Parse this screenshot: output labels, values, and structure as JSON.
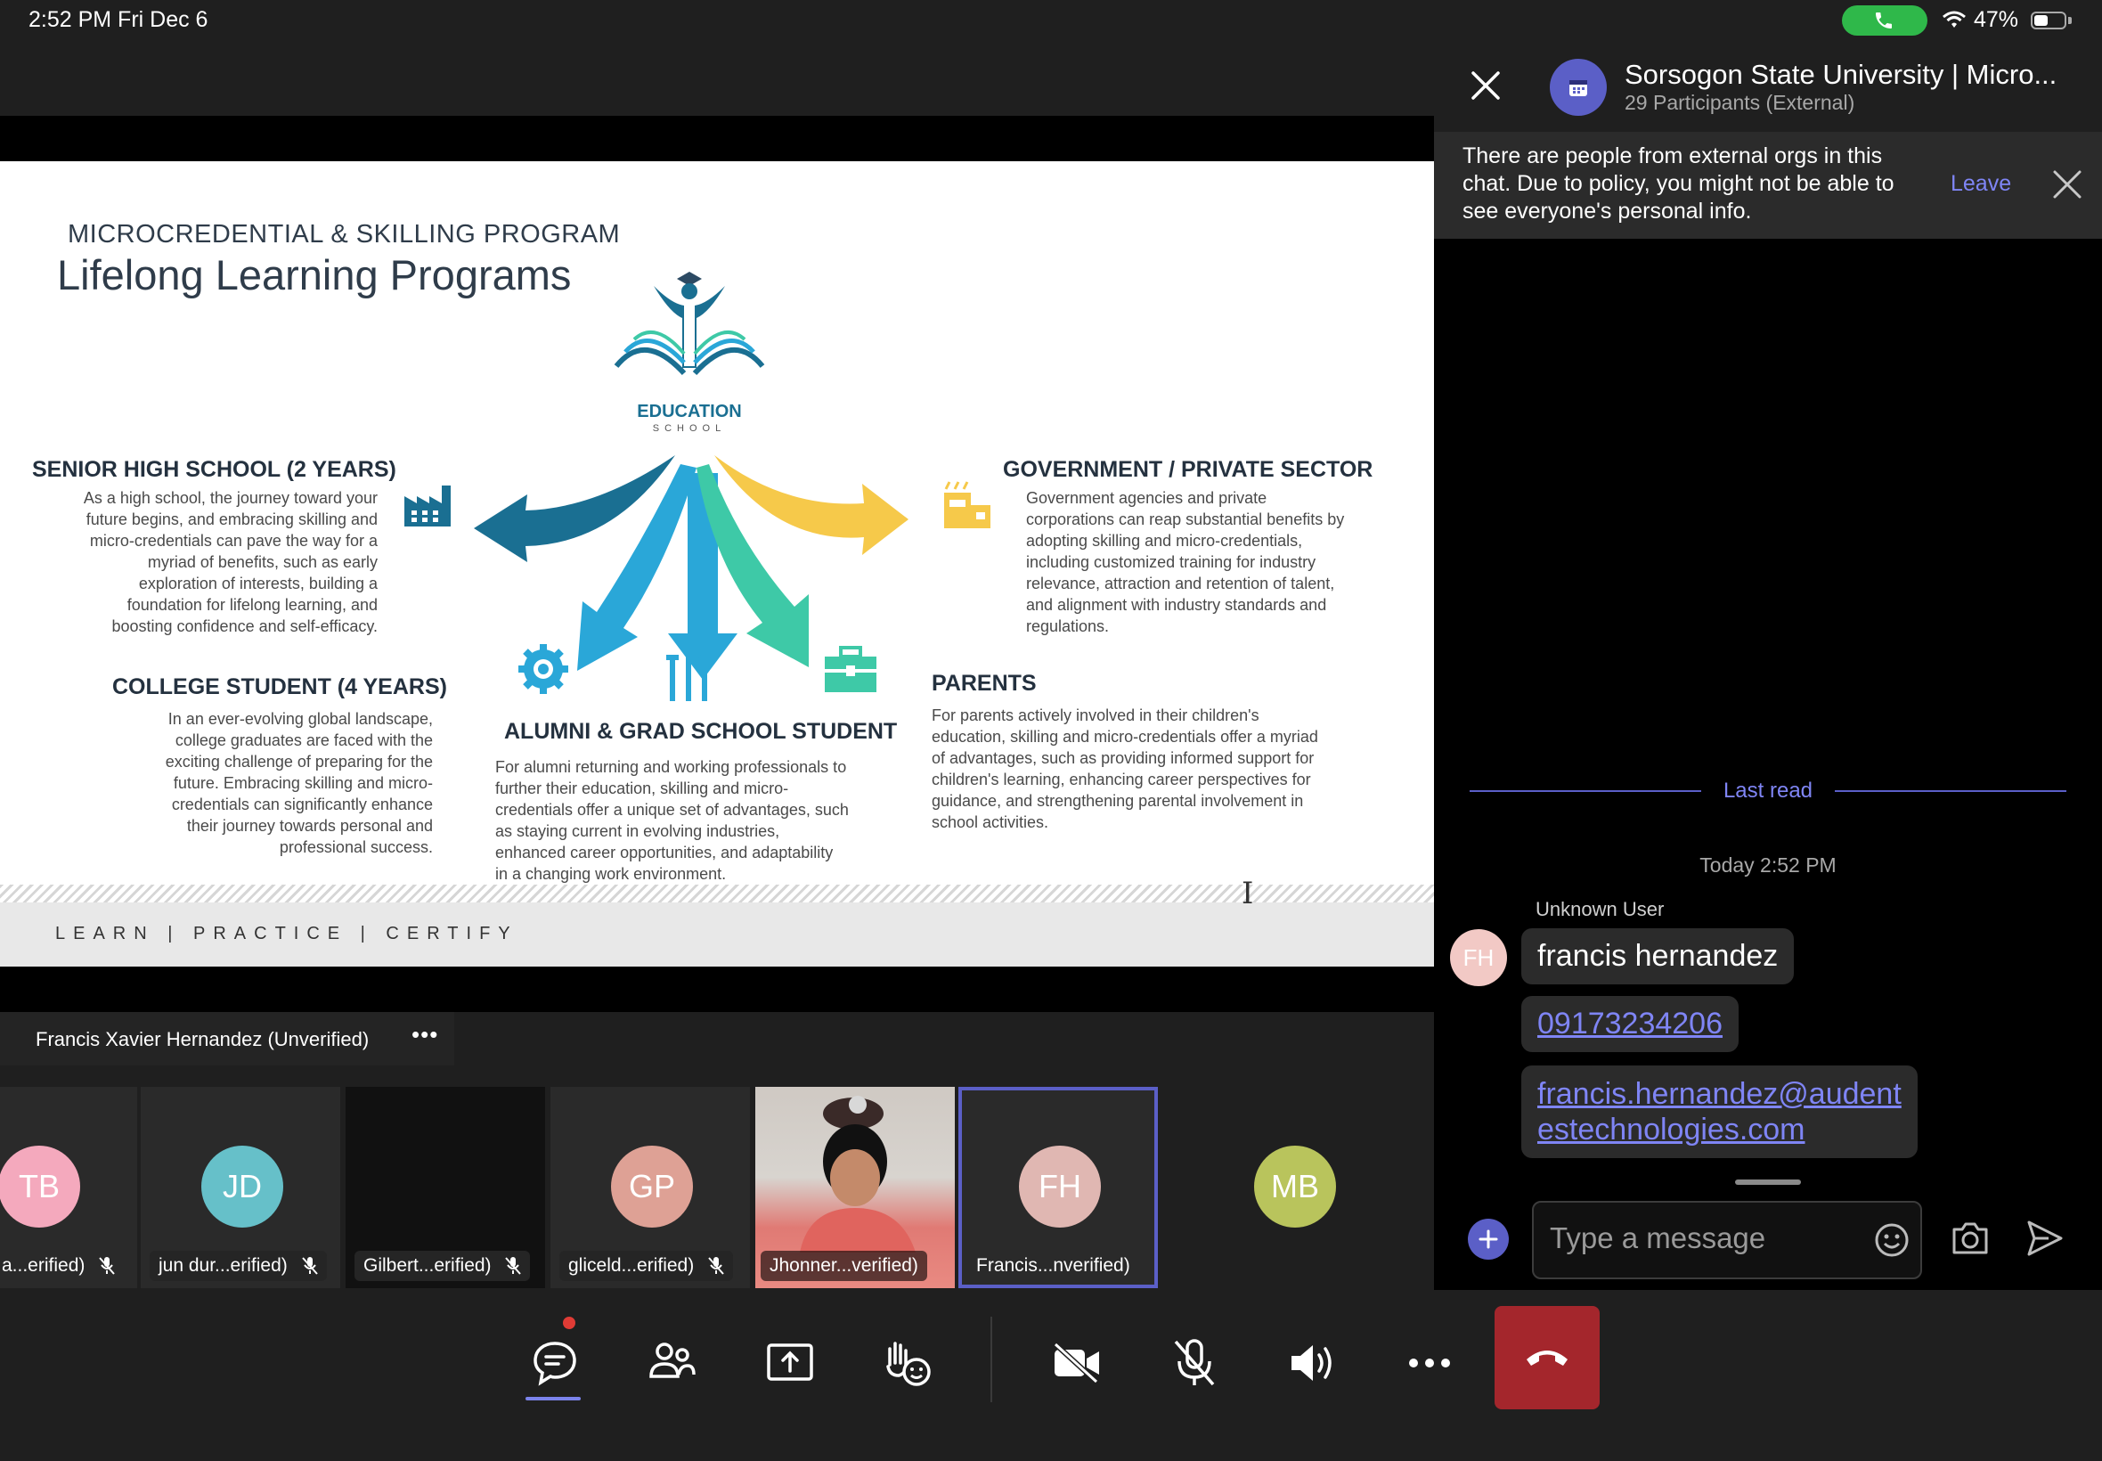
{
  "status_bar": {
    "time": "2:52 PM   Fri Dec 6",
    "battery_text": "47%",
    "battery_level": 0.47,
    "call_pill_color": "#2fb84a"
  },
  "slide": {
    "subtitle": "MICROCREDENTIAL & SKILLING PROGRAM",
    "title": "Lifelong Learning Programs",
    "logo_text": "EDUCATION",
    "logo_subtext": "SCHOOL",
    "sections": {
      "shs": {
        "title": "SENIOR HIGH SCHOOL (2 YEARS)",
        "lines": [
          "As a high school, the journey toward your",
          "future begins, and embracing skilling and",
          "micro-credentials can pave the way for a",
          "myriad of benefits, such as early",
          "exploration of interests, building a",
          "foundation for lifelong learning, and",
          "boosting confidence and self-efficacy."
        ]
      },
      "college": {
        "title": "COLLEGE STUDENT (4 YEARS)",
        "lines": [
          "In an ever-evolving global landscape,",
          "college graduates are faced with the",
          "exciting challenge of preparing for the",
          "future. Embracing skilling and micro-",
          "credentials can significantly enhance",
          "their journey towards personal and",
          "professional success."
        ]
      },
      "alumni": {
        "title": "ALUMNI & GRAD SCHOOL STUDENT",
        "lines": [
          "For alumni returning and working professionals to",
          "further their education, skilling and micro-",
          "credentials offer a unique set of advantages, such",
          "as staying current in evolving industries,",
          "enhanced career opportunities, and adaptability",
          "in a changing work environment."
        ]
      },
      "gov": {
        "title": "GOVERNMENT / PRIVATE SECTOR",
        "lines": [
          "Government agencies and private",
          "corporations can reap substantial benefits by",
          "adopting skilling and micro-credentials,",
          "including customized training for industry",
          "relevance, attraction and retention of talent,",
          "and alignment with industry standards and",
          "regulations."
        ]
      },
      "parents": {
        "title": "PARENTS",
        "lines": [
          "For parents actively involved in their children's",
          "education, skilling and micro-credentials offer a myriad",
          "of advantages, such as providing informed support for",
          "children's learning, enhancing career perspectives for",
          "guidance, and strengthening parental involvement in",
          "school activities."
        ]
      }
    },
    "footer": "LEARN  |  PRACTICE  |  CERTIFY",
    "colors": {
      "dark_blue": "#1a6f92",
      "teal_blue": "#2aa7d8",
      "green": "#3ec9a7",
      "yellow": "#f6c94a"
    }
  },
  "presenter": {
    "name": "Francis Xavier Hernandez (Unverified)",
    "more_label": "•••"
  },
  "participants": [
    {
      "initials": "TB",
      "name": "a...erified)",
      "color": "#f4a9bd",
      "muted": true
    },
    {
      "initials": "JD",
      "name": "jun dur...erified)",
      "color": "#66c0c9",
      "muted": true
    },
    {
      "initials": "",
      "name": "Gilbert...erified)",
      "color": "",
      "muted": true
    },
    {
      "initials": "GP",
      "name": "gliceld...erified)",
      "color": "#dea195",
      "muted": true
    },
    {
      "initials": "",
      "name": "Jhonner...verified)",
      "color": "",
      "muted": false
    },
    {
      "initials": "FH",
      "name": "Francis...nverified)",
      "color": "#e0b7b2",
      "muted": false
    },
    {
      "initials": "MB",
      "name": "",
      "color": "#b9c45c",
      "muted": false
    }
  ],
  "controls": {
    "chat_icon": "chat-icon",
    "people_icon": "people-icon",
    "share_icon": "share-tray-icon",
    "react_icon": "raise-hand-icon",
    "camera_icon": "video-off-icon",
    "mic_icon": "mic-off-icon",
    "speaker_icon": "speaker-icon",
    "more_icon": "more-icon",
    "hangup_icon": "hang-up-icon",
    "hangup_color": "#a4262c",
    "accent": "#7b83eb"
  },
  "chat": {
    "title": "Sorsogon State University | Micro...",
    "subtitle": "29 Participants (External)",
    "notice": "There are people from external orgs in this chat. Due to policy, you might not be able to see everyone's personal info.",
    "leave_label": "Leave",
    "last_read": "Last read",
    "day_stamp": "Today 2:52 PM",
    "sender": "Unknown User",
    "avatar_initials": "FH",
    "messages": [
      {
        "text": "francis hernandez",
        "link": false
      },
      {
        "text": "09173234206",
        "link": true
      },
      {
        "text": "francis.hernandez@audentestechnologies.com",
        "line1": "francis.hernandez@audent",
        "line2": "estechnologies.com",
        "link": true
      }
    ],
    "compose_placeholder": "Type a message",
    "accent": "#5b5fc7"
  }
}
